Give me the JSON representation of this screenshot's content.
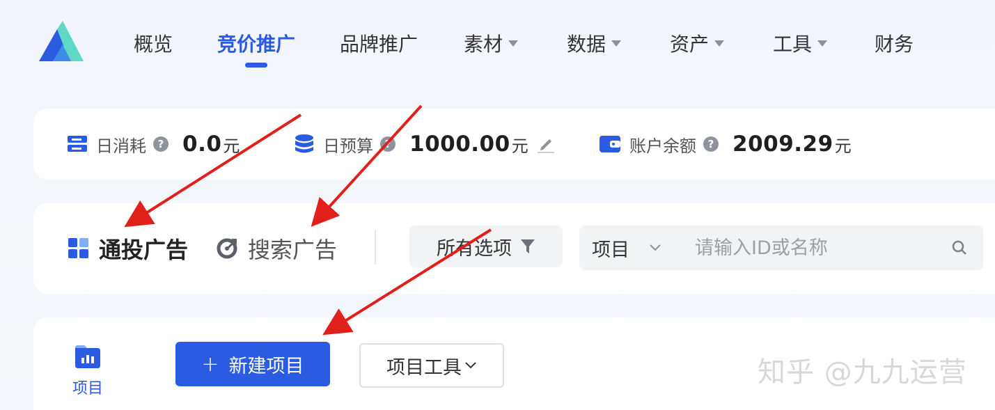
{
  "nav": {
    "items": [
      {
        "label": "概览",
        "dropdown": false,
        "active": false
      },
      {
        "label": "竞价推广",
        "dropdown": false,
        "active": true
      },
      {
        "label": "品牌推广",
        "dropdown": false,
        "active": false
      },
      {
        "label": "素材",
        "dropdown": true,
        "active": false
      },
      {
        "label": "数据",
        "dropdown": true,
        "active": false
      },
      {
        "label": "资产",
        "dropdown": true,
        "active": false
      },
      {
        "label": "工具",
        "dropdown": true,
        "active": false
      },
      {
        "label": "财务",
        "dropdown": false,
        "active": false
      }
    ]
  },
  "stats": {
    "daily_spend": {
      "label": "日消耗",
      "value": "0.0",
      "unit": "元",
      "icon": "server-icon"
    },
    "daily_budget": {
      "label": "日预算",
      "value": "1000.00",
      "unit": "元",
      "icon": "database-icon"
    },
    "balance": {
      "label": "账户余额",
      "value": "2009.29",
      "unit": "元",
      "icon": "wallet-icon"
    },
    "help_glyph": "?"
  },
  "tabs": {
    "general": {
      "label": "通投广告",
      "icon": "grid-icon"
    },
    "search": {
      "label": "搜索广告",
      "icon": "search-ad-icon"
    },
    "filter_label": "所有选项",
    "search_scope": "项目",
    "search_placeholder": "请输入ID或名称"
  },
  "project": {
    "icon_label": "项目",
    "new_button": "新建项目",
    "new_button_glyph": "+",
    "tools_button": "项目工具"
  },
  "watermark": "知乎 @九九运营",
  "colors": {
    "accent": "#2b5be0",
    "arrow": "#e0201a"
  }
}
